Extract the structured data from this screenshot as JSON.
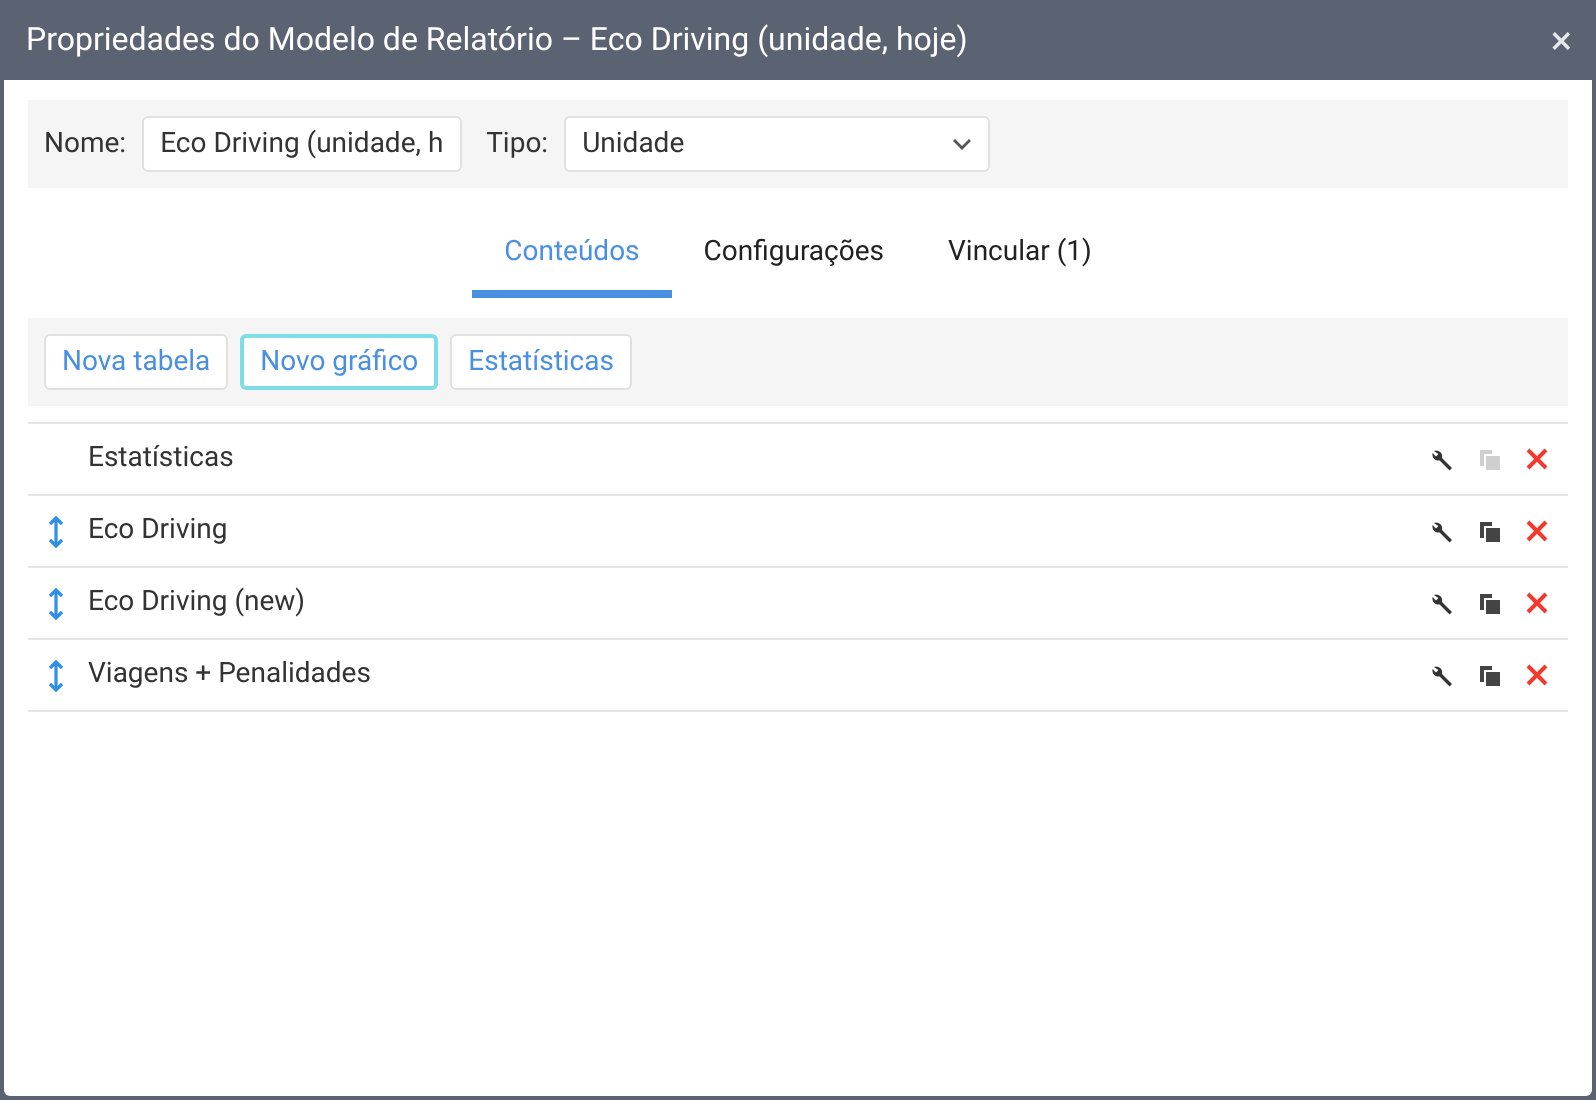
{
  "window": {
    "title": "Propriedades do Modelo de Relatório – Eco Driving (unidade, hoje)",
    "close": "×"
  },
  "name_field": {
    "label": "Nome:",
    "value": "Eco Driving (unidade, h"
  },
  "type_field": {
    "label": "Tipo:",
    "value": "Unidade"
  },
  "tabs": [
    {
      "label": "Conteúdos",
      "selected": true
    },
    {
      "label": "Configurações",
      "selected": false
    },
    {
      "label": "Vincular (1)",
      "selected": false
    }
  ],
  "toolbar": [
    {
      "label": "Nova tabela",
      "focused": false
    },
    {
      "label": "Novo gráfico",
      "focused": true
    },
    {
      "label": "Estatísticas",
      "focused": false
    }
  ],
  "items": [
    {
      "name": "Estatísticas",
      "movable": false,
      "copy_disabled": true
    },
    {
      "name": "Eco Driving",
      "movable": true,
      "copy_disabled": false
    },
    {
      "name": "Eco Driving (new)",
      "movable": true,
      "copy_disabled": false
    },
    {
      "name": "Viagens + Penalidades",
      "movable": true,
      "copy_disabled": false
    }
  ]
}
